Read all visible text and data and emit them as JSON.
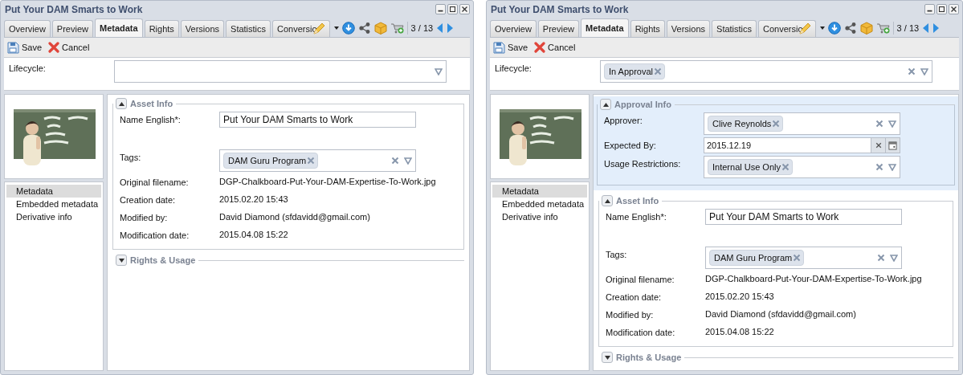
{
  "windows": [
    {
      "title": "Put Your DAM Smarts to Work",
      "tabs": [
        {
          "label": "Overview",
          "selected": false
        },
        {
          "label": "Preview",
          "selected": false
        },
        {
          "label": "Metadata",
          "selected": true
        },
        {
          "label": "Rights",
          "selected": false
        },
        {
          "label": "Versions",
          "selected": false
        },
        {
          "label": "Statistics",
          "selected": false
        },
        {
          "label": "Conversio",
          "selected": false
        }
      ],
      "counter": "3 / 13",
      "toolbar": {
        "save": "Save",
        "cancel": "Cancel"
      },
      "lifecycle": {
        "label": "Lifecycle:"
      },
      "preview": {
        "kind": "picture"
      },
      "nav": [
        {
          "label": "Metadata",
          "selected": true
        },
        {
          "label": "Embedded metadata",
          "selected": false
        },
        {
          "label": "Derivative info",
          "selected": false
        }
      ],
      "sections": [
        {
          "title": "Asset Info",
          "expanded": true,
          "highlighted": false,
          "fields": [
            {
              "kind": "text",
              "label": "Name English*:",
              "value": "Put Your DAM Smarts to Work"
            },
            {
              "kind": "tags",
              "label": "Tags:",
              "tags": [
                "DAM Guru Program"
              ]
            },
            {
              "kind": "static",
              "label": "Original filename:",
              "value": "DGP-Chalkboard-Put-Your-DAM-Expertise-To-Work.jpg"
            },
            {
              "kind": "static",
              "label": "Creation date:",
              "value": "2015.02.20 15:43"
            },
            {
              "kind": "static",
              "label": "Modified by:",
              "value": "David Diamond (sfdavidd@gmail.com)"
            },
            {
              "kind": "static",
              "label": "Modification date:",
              "value": "2015.04.08 15:22"
            }
          ]
        },
        {
          "title": "Rights & Usage",
          "expanded": false,
          "highlighted": false
        }
      ]
    },
    {
      "title": "Put Your DAM Smarts to Work",
      "tabs": [
        {
          "label": "Overview",
          "selected": false
        },
        {
          "label": "Preview",
          "selected": false
        },
        {
          "label": "Metadata",
          "selected": true
        },
        {
          "label": "Rights",
          "selected": false
        },
        {
          "label": "Versions",
          "selected": false
        },
        {
          "label": "Statistics",
          "selected": false
        },
        {
          "label": "Conversio",
          "selected": false
        }
      ],
      "counter": "3 / 13",
      "toolbar": {
        "save": "Save",
        "cancel": "Cancel"
      },
      "lifecycle": {
        "label": "Lifecycle:",
        "tags": [
          "In Approval"
        ]
      },
      "preview": {
        "kind": "picture"
      },
      "nav": [
        {
          "label": "Metadata",
          "selected": true
        },
        {
          "label": "Embedded metadata",
          "selected": false
        },
        {
          "label": "Derivative info",
          "selected": false
        }
      ],
      "sections": [
        {
          "title": "Approval Info",
          "expanded": true,
          "highlighted": true,
          "fields": [
            {
              "kind": "tags",
              "label": "Approver:",
              "tags": [
                "Clive Reynolds"
              ]
            },
            {
              "kind": "date",
              "label": "Expected By:",
              "value": "2015.12.19"
            },
            {
              "kind": "tags",
              "label": "Usage Restrictions:",
              "tags": [
                "Internal Use Only"
              ]
            }
          ]
        },
        {
          "title": "Asset Info",
          "expanded": true,
          "highlighted": false,
          "fields": [
            {
              "kind": "text",
              "label": "Name English*:",
              "value": "Put Your DAM Smarts to Work"
            },
            {
              "kind": "tags",
              "label": "Tags:",
              "tags": [
                "DAM Guru Program"
              ]
            },
            {
              "kind": "static",
              "label": "Original filename:",
              "value": "DGP-Chalkboard-Put-Your-DAM-Expertise-To-Work.jpg"
            },
            {
              "kind": "static",
              "label": "Creation date:",
              "value": "2015.02.20 15:43"
            },
            {
              "kind": "static",
              "label": "Modified by:",
              "value": "David Diamond (sfdavidd@gmail.com)"
            },
            {
              "kind": "static",
              "label": "Modification date:",
              "value": "2015.04.08 15:22"
            }
          ]
        },
        {
          "title": "Rights & Usage",
          "expanded": false,
          "highlighted": false
        }
      ]
    }
  ]
}
